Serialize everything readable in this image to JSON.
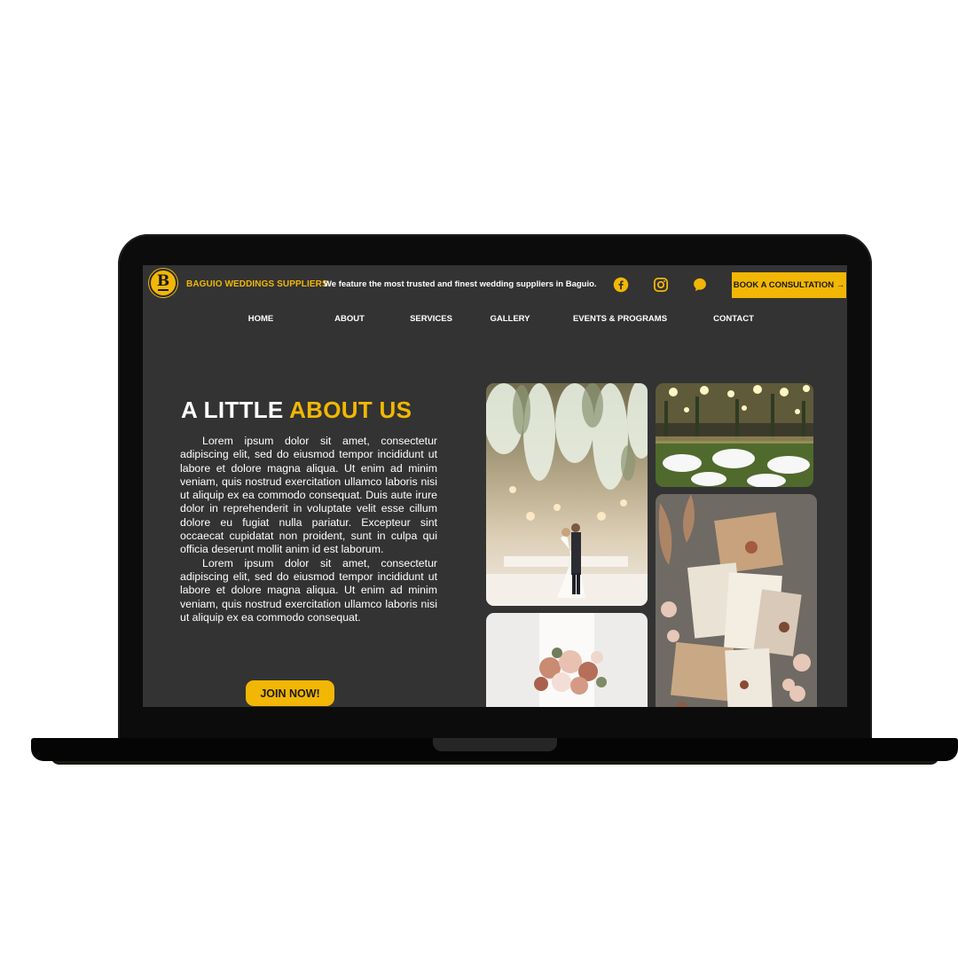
{
  "header": {
    "logo_letter": "B",
    "brand": "BAGUIO WEDDINGS SUPPLIERS.",
    "tagline": "We feature the most trusted and finest wedding suppliers in Baguio.",
    "social_icons": [
      "facebook-icon",
      "instagram-icon",
      "chat-icon"
    ],
    "cta_label": "BOOK A CONSULTATION →"
  },
  "nav": {
    "items": [
      "HOME",
      "ABOUT",
      "SERVICES",
      "GALLERY",
      "EVENTS & PROGRAMS",
      "CONTACT"
    ]
  },
  "about": {
    "title_part1": "A LITTLE",
    "title_part2": "ABOUT US",
    "paragraphs": [
      "Lorem ipsum dolor sit amet, consectetur adipiscing elit, sed do eiusmod tempor incididunt ut labore et dolore magna aliqua. Ut enim ad minim veniam, quis nostrud exercitation ullamco laboris nisi ut aliquip ex ea commodo consequat. Duis aute irure dolor in reprehenderit in voluptate velit esse cillum dolore eu fugiat nulla pariatur. Excepteur sint occaecat cupidatat non proident, sunt in culpa qui officia deserunt mollit anim id est laborum.",
      "Lorem ipsum dolor sit amet, consectetur adipiscing elit, sed do eiusmod tempor incididunt ut labore et dolore magna aliqua. Ut enim ad minim veniam, quis nostrud exercitation ullamco laboris nisi ut aliquip ex ea commodo consequat."
    ],
    "join_label": "JOIN NOW!"
  },
  "colors": {
    "accent": "#f2b705",
    "background": "#333333",
    "text": "#ffffff"
  }
}
